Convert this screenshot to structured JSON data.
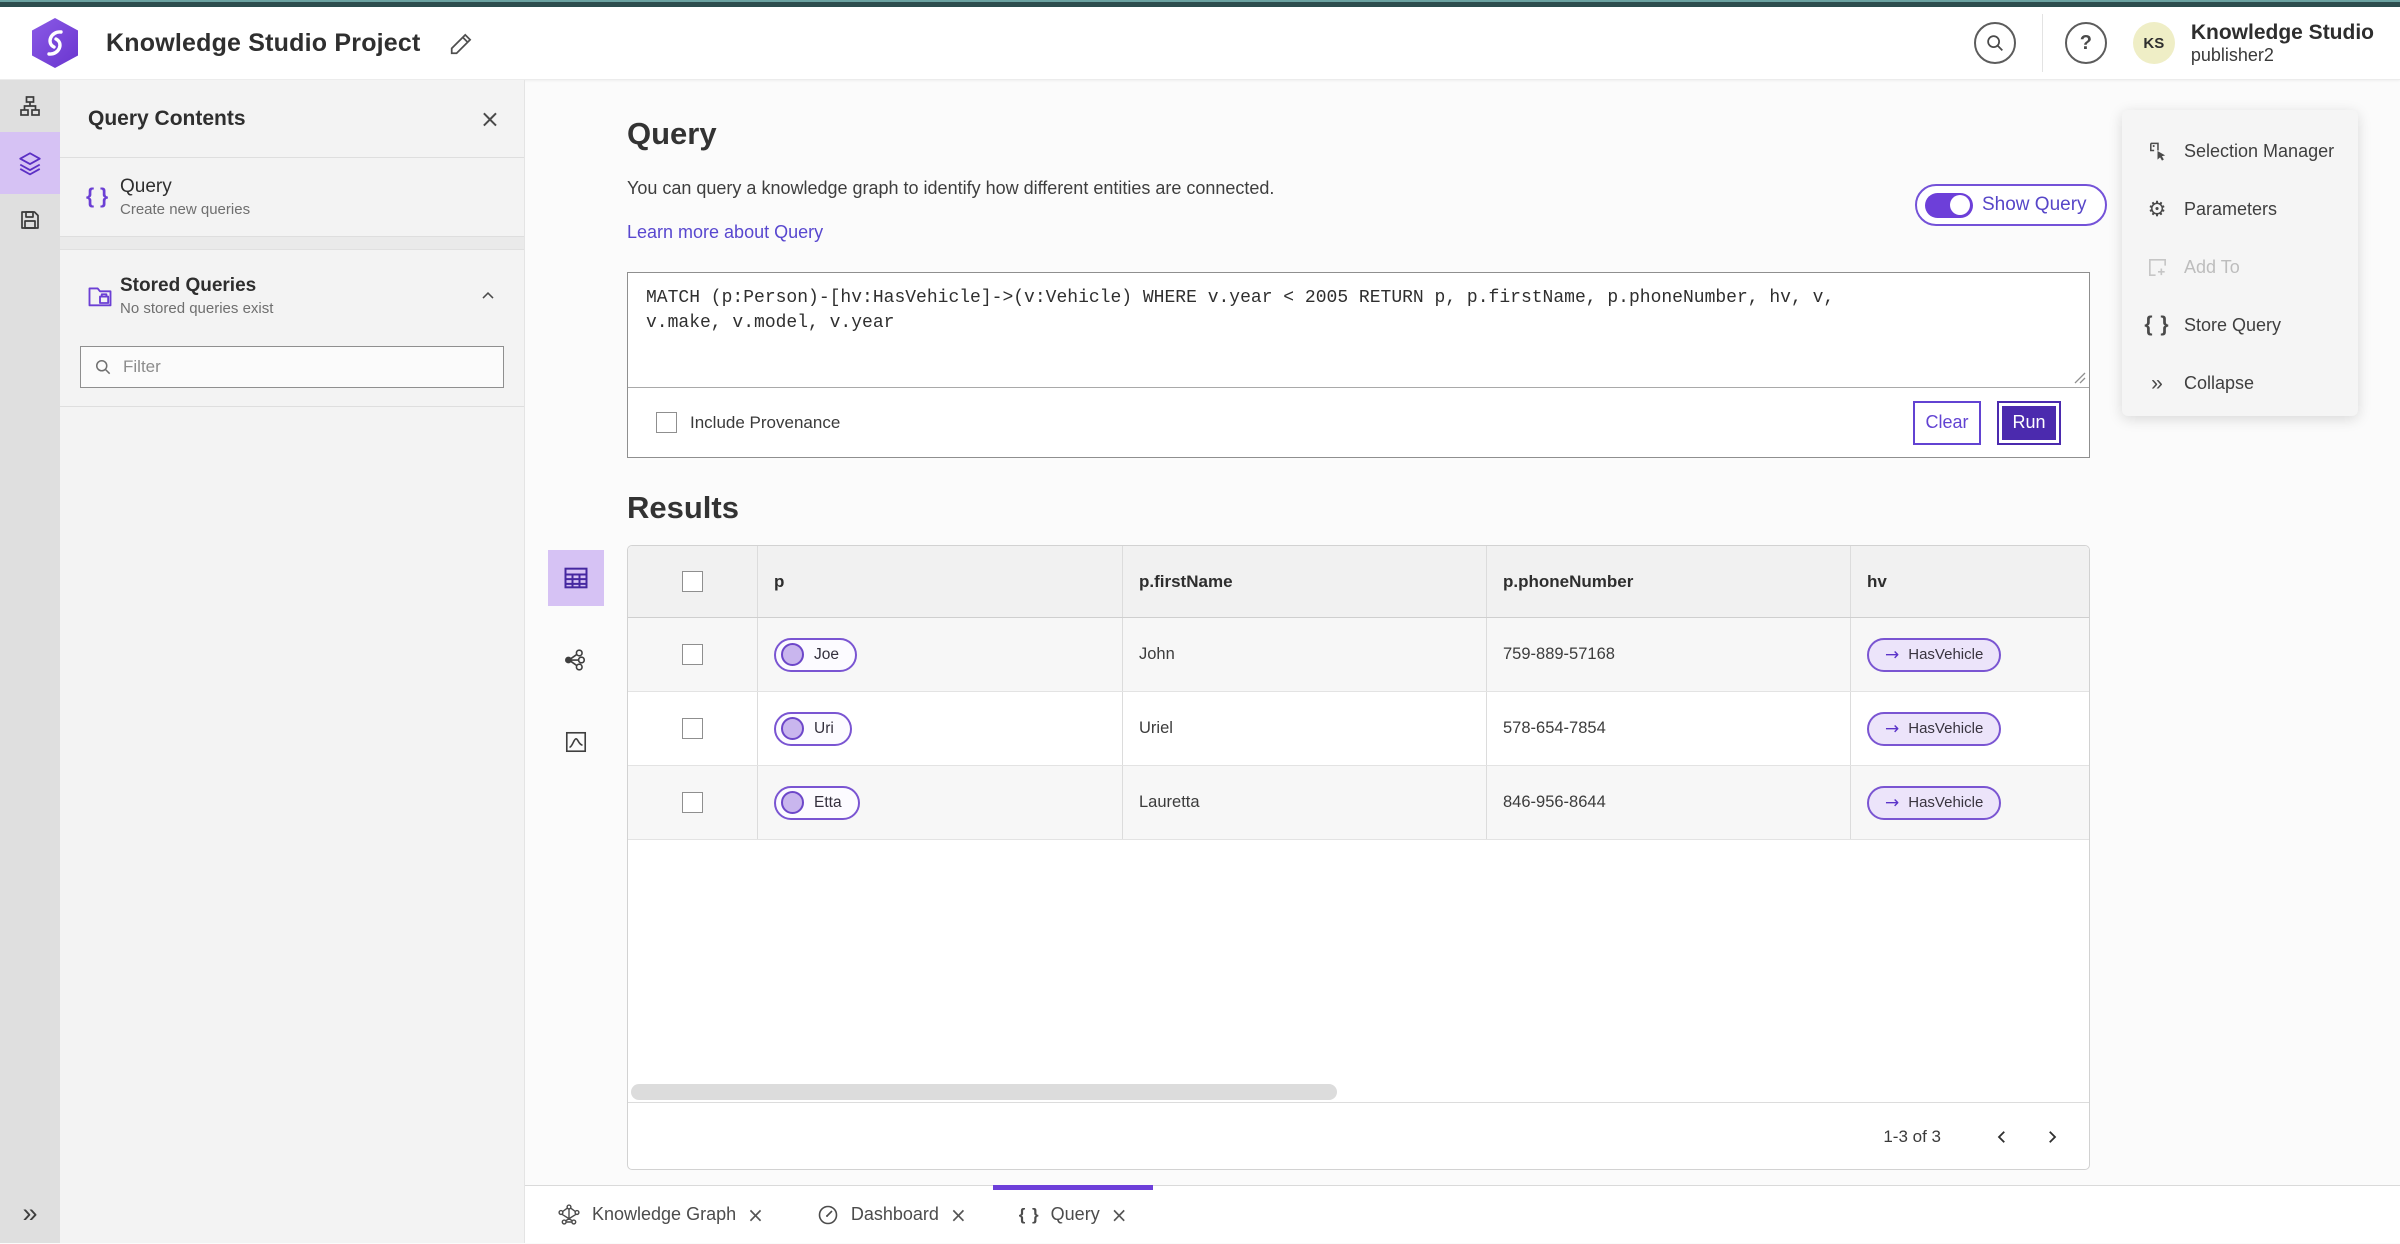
{
  "header": {
    "title": "Knowledge Studio Project",
    "product": "Knowledge Studio",
    "user": "publisher2",
    "avatar_initials": "KS"
  },
  "icons": {
    "help": "?",
    "close": "×",
    "arrow_right": "→",
    "double_chevron": "»",
    "gear": "⚙",
    "brace": "{ }"
  },
  "panel": {
    "title": "Query Contents",
    "query_item": {
      "label": "Query",
      "sublabel": "Create new queries"
    },
    "stored": {
      "label": "Stored Queries",
      "sublabel": "No stored queries exist"
    },
    "filter_placeholder": "Filter"
  },
  "query": {
    "heading": "Query",
    "description": "You can query a knowledge graph to identify how different entities are connected.",
    "learn_more": "Learn more about Query",
    "show_query": "Show Query",
    "text": "MATCH (p:Person)-[hv:HasVehicle]->(v:Vehicle) WHERE v.year < 2005 RETURN p, p.firstName, p.phoneNumber, hv, v, v.make, v.model, v.year",
    "include_provenance": "Include Provenance",
    "clear": "Clear",
    "run": "Run"
  },
  "results": {
    "heading": "Results",
    "columns": [
      "p",
      "p.firstName",
      "p.phoneNumber",
      "hv"
    ],
    "rows": [
      {
        "p": "Joe",
        "firstName": "John",
        "phoneNumber": "759-889-57168",
        "hv": "HasVehicle"
      },
      {
        "p": "Uri",
        "firstName": "Uriel",
        "phoneNumber": "578-654-7854",
        "hv": "HasVehicle"
      },
      {
        "p": "Etta",
        "firstName": "Lauretta",
        "phoneNumber": "846-956-8644",
        "hv": "HasVehicle"
      }
    ],
    "pagination": "1-3 of 3"
  },
  "right_panel": {
    "items": [
      {
        "label": "Selection Manager"
      },
      {
        "label": "Parameters"
      },
      {
        "label": "Add To"
      },
      {
        "label": "Store Query"
      },
      {
        "label": "Collapse"
      }
    ]
  },
  "tabs": [
    {
      "label": "Knowledge Graph"
    },
    {
      "label": "Dashboard"
    },
    {
      "label": "Query"
    }
  ]
}
